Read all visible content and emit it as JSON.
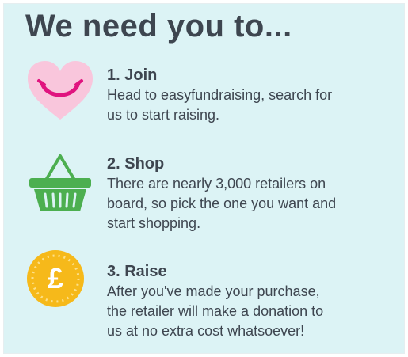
{
  "title": "We need you to...",
  "steps": [
    {
      "heading": "1. Join",
      "lines": [
        "Head to easyfundraising, search for",
        "us to start raising."
      ],
      "icon": "heart-smile-icon"
    },
    {
      "heading": "2. Shop",
      "lines": [
        "There are nearly 3,000 retailers on",
        "board, so pick the one you want and",
        "start shopping."
      ],
      "icon": "shopping-basket-icon"
    },
    {
      "heading": "3. Raise",
      "lines": [
        "After you've made your purchase,",
        "the retailer will make a donation to",
        "us at no extra cost whatsoever!"
      ],
      "icon": "pound-coin-icon",
      "icon_label": "£"
    }
  ],
  "colors": {
    "background": "#dcf3f5",
    "text": "#3e4650",
    "heart": "#f9c6dc",
    "smile": "#e0147f",
    "basket": "#4caf50",
    "coin": "#f6b91a"
  }
}
